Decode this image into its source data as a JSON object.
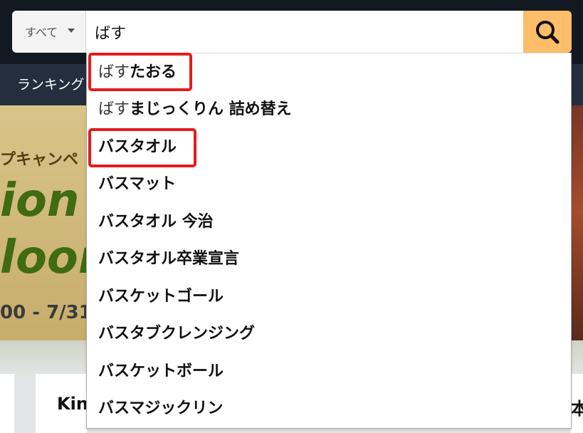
{
  "header": {
    "category_label": "すべて",
    "search_value": "ばす",
    "search_icon": "search-icon"
  },
  "subnav": {
    "item": "ランキング"
  },
  "background": {
    "campaign_text": "プキャンペ",
    "banner_line1": "ion ×",
    "banner_line2": "loor",
    "banner_date": "00 - 7/31",
    "card_left_text": "Kin う",
    "card_right_text": "本を"
  },
  "suggestions": [
    {
      "typed": "ばす",
      "rest": "たおる",
      "highlighted": true
    },
    {
      "typed": "ばす",
      "rest": "まじっくりん 詰め替え",
      "highlighted": false
    },
    {
      "typed": "",
      "rest": "バスタオル",
      "highlighted": true
    },
    {
      "typed": "",
      "rest": "バスマット",
      "highlighted": false
    },
    {
      "typed": "",
      "rest": "バスタオル 今治",
      "highlighted": false
    },
    {
      "typed": "",
      "rest": "バスタオル卒業宣言",
      "highlighted": false
    },
    {
      "typed": "",
      "rest": "バスケットゴール",
      "highlighted": false
    },
    {
      "typed": "",
      "rest": "バスタブクレンジング",
      "highlighted": false
    },
    {
      "typed": "",
      "rest": "バスケットボール",
      "highlighted": false
    },
    {
      "typed": "",
      "rest": "バスマジックリン",
      "highlighted": false
    }
  ],
  "colors": {
    "header_bg": "#131921",
    "subnav_bg": "#232f3e",
    "search_button": "#febd69",
    "highlight_box": "#e31c1c"
  }
}
